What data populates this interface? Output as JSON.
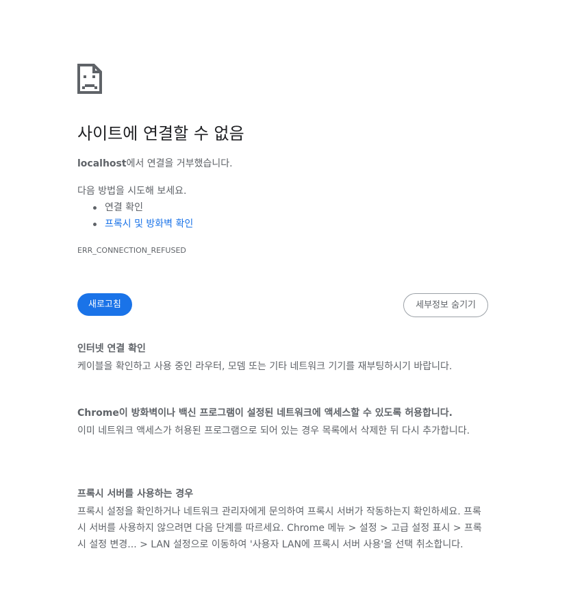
{
  "error": {
    "title": "사이트에 연결할 수 없음",
    "host": "localhost",
    "refused_suffix": "에서 연결을 거부했습니다.",
    "try_label": "다음 방법을 시도해 보세요.",
    "suggestions": [
      {
        "label": "연결 확인",
        "is_link": false
      },
      {
        "label": "프록시 및 방화벽 확인",
        "is_link": true
      }
    ],
    "code": "ERR_CONNECTION_REFUSED",
    "icon": "sad-page-icon"
  },
  "buttons": {
    "reload": "새로고침",
    "hide_details": "세부정보 숨기기"
  },
  "details": [
    {
      "heading": "인터넷 연결 확인",
      "body": "케이블을 확인하고 사용 중인 라우터, 모뎀 또는 기타 네트워크 기기를 재부팅하시기 바랍니다."
    },
    {
      "heading": "Chrome이 방화벽이나 백신 프로그램이 설정된 네트워크에 액세스할 수 있도록 허용합니다.",
      "body": "이미 네트워크 액세스가 허용된 프로그램으로 되어 있는 경우 목록에서 삭제한 뒤 다시 추가합니다."
    },
    {
      "heading": "프록시 서버를 사용하는 경우",
      "body": "프록시 설정을 확인하거나 네트워크 관리자에게 문의하여 프록시 서버가 작동하는지 확인하세요. 프록시 서버를 사용하지 않으려면 다음 단계를 따르세요. Chrome 메뉴 > 설정 > 고급 설정 표시 > 프록시 설정 변경... > LAN 설정으로 이동하여 '사용자 LAN에 프록시 서버 사용'을 선택 취소합니다."
    }
  ],
  "colors": {
    "accent": "#1a73e8",
    "text_primary": "#202124",
    "text_secondary": "#5f6368"
  }
}
